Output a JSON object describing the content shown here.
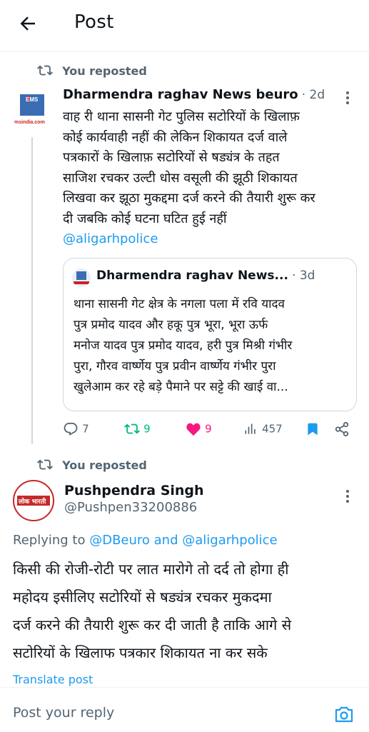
{
  "header": {
    "title": "Post"
  },
  "post1": {
    "repost_label": "You reposted",
    "author": "Dharmendra raghav News beuro",
    "time": "· 2d",
    "avatar_text": "msindia.com",
    "avatar_logo": "EMS",
    "text_lines": [
      "वाह री थाना सासनी गेट पुलिस सटोरियों के खिलाफ़",
      "कोई कार्यवाही नहीं की लेकिन शिकायत दर्ज वाले",
      "पत्रकारों के खिलाफ़ सटोरियों से षड्यंत्र के तहत",
      "साजिश रचकर उल्टी धोस वसूली की झूठी शिकायत",
      "लिखवा कर झूठा मुकद्दमा दर्ज करने की तैयारी शुरू कर",
      "दी जबकि कोई घटना घटित हुई नहीं"
    ],
    "mention": "@aligarhpolice",
    "quote": {
      "author": "Dharmendra raghav News...",
      "time": "· 3d",
      "lines": [
        "थाना सासनी गेट क्षेत्र के नगला पला में रवि यादव",
        "पुत्र प्रमोद यादव और हकू पुत्र भूरा, भूरा ऊर्फ",
        "मनोज यादव पुत्र प्रमोद यादव, हरी पुत्र मिश्री गंभीर",
        "पुरा, गौरव वार्ष्णेय पुत्र प्रवीन वार्ष्णेय गंभीर पुरा",
        "खुलेआम कर रहे बड़े पैमाने पर सट्टे की खाई वा..."
      ]
    },
    "stats": {
      "replies": "7",
      "reposts": "9",
      "likes": "9",
      "views": "457"
    }
  },
  "post2": {
    "repost_label": "You reposted",
    "author": "Pushpendra Singh",
    "handle": "@Pushpen33200886",
    "avatar_text": "लोक भारती",
    "replying_prefix": "Replying to ",
    "replying_to_1": "@DBeuro",
    "replying_and": " and ",
    "replying_to_2": "@aligarhpolice",
    "text_lines": [
      "किसी की रोजी-रोटी पर लात मारोगे तो दर्द तो होगा ही",
      "महोदय इसीलिए सटोरियों से षड्यंत्र रचकर मुकदमा",
      "दर्ज करने की तैयारी शुरू कर दी जाती है ताकि आगे से",
      "सटोरियों के खिलाफ पत्रकार शिकायत ना कर सके"
    ],
    "translate": "Translate post"
  },
  "reply": {
    "placeholder": "Post your reply"
  },
  "colors": {
    "accent": "#1d9bf0",
    "like": "#f91880",
    "repost": "#00ba7c",
    "muted": "#536471"
  }
}
